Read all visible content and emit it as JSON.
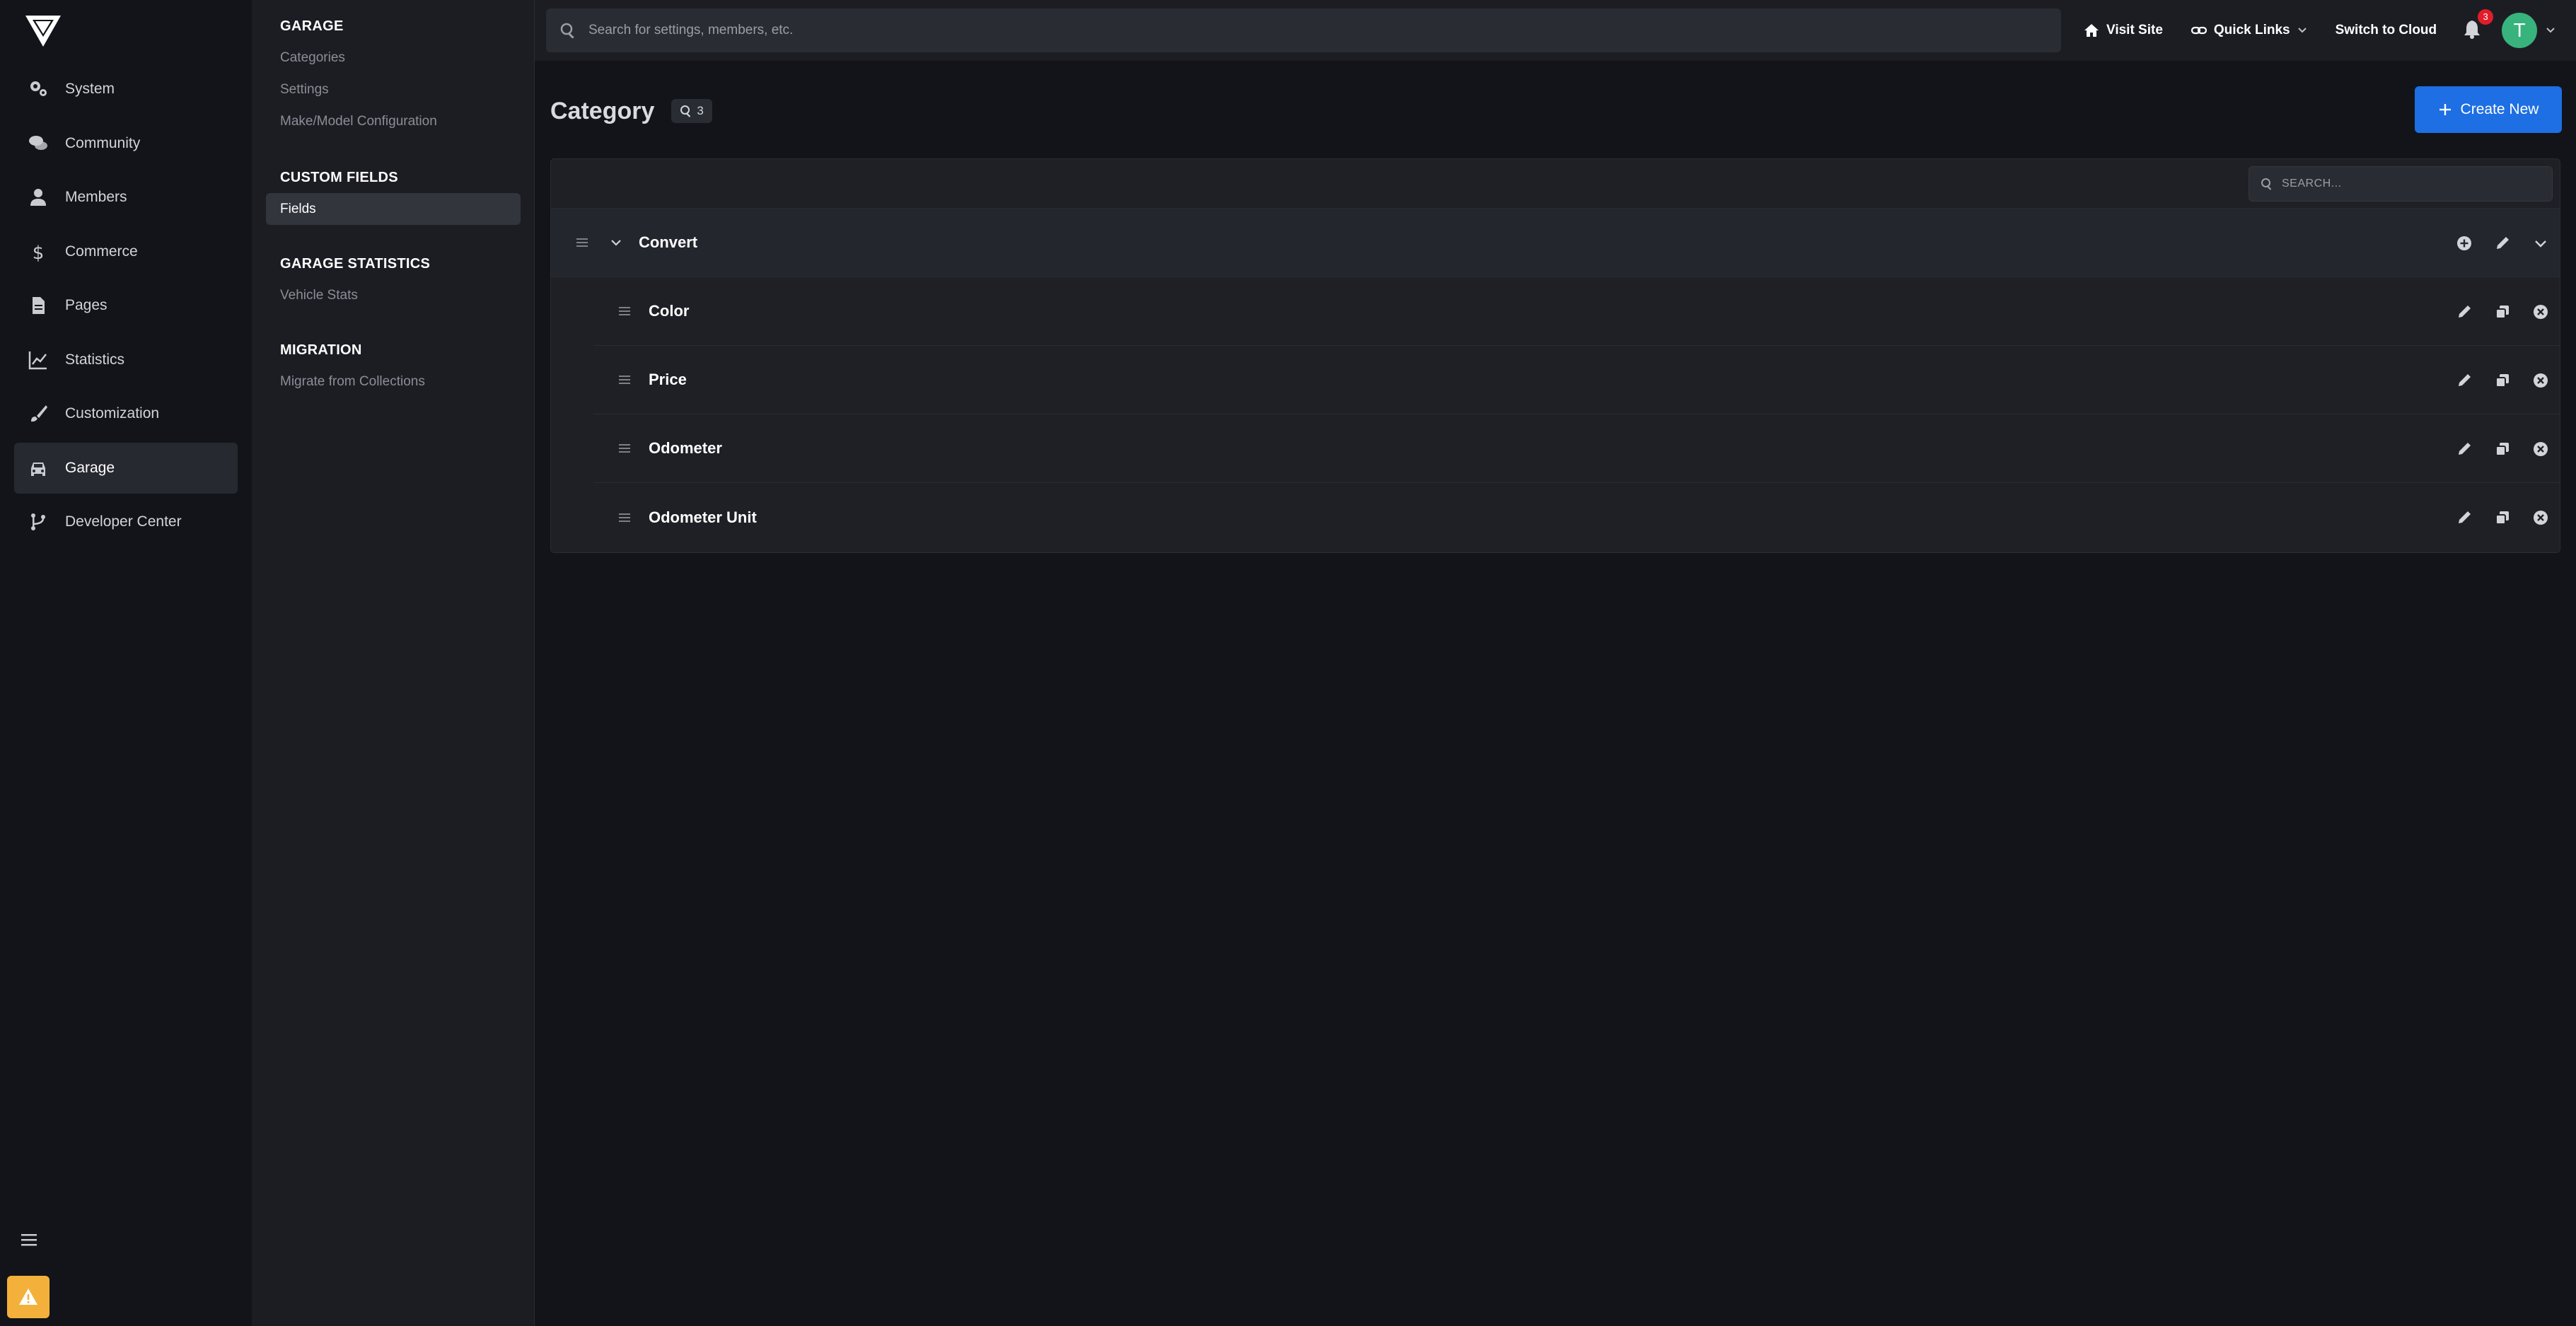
{
  "sidebar": {
    "items": [
      {
        "label": "System",
        "icon": "gears-icon"
      },
      {
        "label": "Community",
        "icon": "comments-icon"
      },
      {
        "label": "Members",
        "icon": "user-icon"
      },
      {
        "label": "Commerce",
        "icon": "dollar-icon"
      },
      {
        "label": "Pages",
        "icon": "file-icon"
      },
      {
        "label": "Statistics",
        "icon": "chart-line-icon"
      },
      {
        "label": "Customization",
        "icon": "brush-icon"
      },
      {
        "label": "Garage",
        "icon": "car-icon",
        "active": true
      },
      {
        "label": "Developer Center",
        "icon": "code-branch-icon"
      }
    ]
  },
  "subnav": {
    "groups": [
      {
        "heading": "GARAGE",
        "links": [
          "Categories",
          "Settings",
          "Make/Model Configuration"
        ]
      },
      {
        "heading": "CUSTOM FIELDS",
        "links": [
          "Fields"
        ],
        "active": "Fields"
      },
      {
        "heading": "GARAGE STATISTICS",
        "links": [
          "Vehicle Stats"
        ]
      },
      {
        "heading": "MIGRATION",
        "links": [
          "Migrate from Collections"
        ]
      }
    ]
  },
  "topbar": {
    "search_placeholder": "Search for settings, members, etc.",
    "visit_site": "Visit Site",
    "quick_links": "Quick Links",
    "switch_cloud": "Switch to Cloud",
    "notification_count": "3",
    "avatar_initial": "T"
  },
  "main": {
    "title": "Category",
    "count": "3",
    "create_label": "Create New",
    "search_placeholder": "SEARCH...",
    "category": {
      "label": "Convert"
    },
    "fields": [
      "Color",
      "Price",
      "Odometer",
      "Odometer Unit"
    ]
  },
  "colors": {
    "accent": "#1d6fe3",
    "warning": "#f3b13b",
    "avatar": "#38b37e",
    "badge": "#e11d2a"
  }
}
